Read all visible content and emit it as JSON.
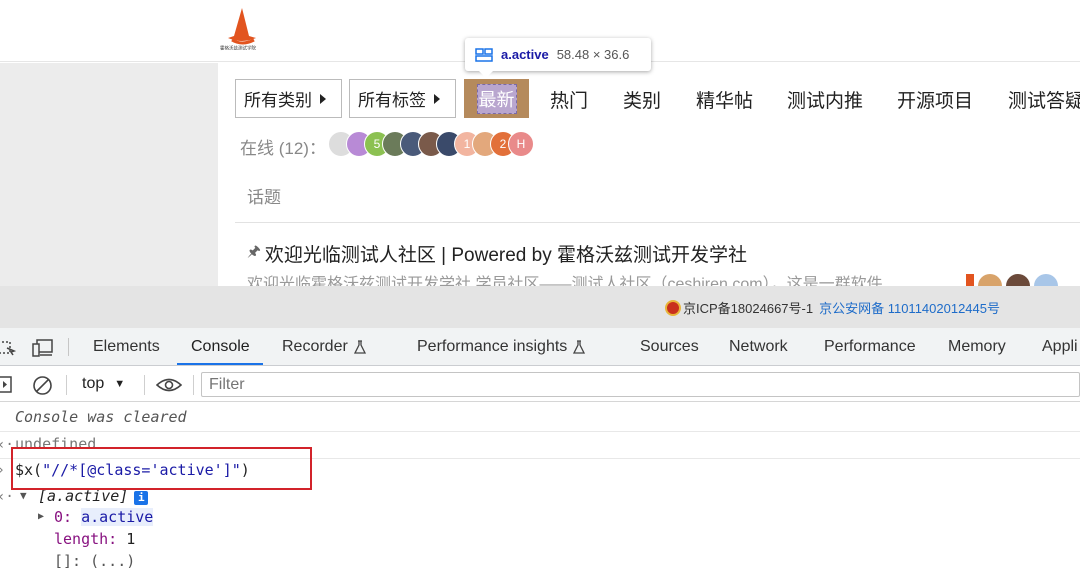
{
  "site": {
    "logo_text": "霍格沃兹测试学院",
    "filters": [
      {
        "label": "所有类别"
      },
      {
        "label": "所有标签"
      }
    ],
    "nav": [
      {
        "label": "最新"
      },
      {
        "label": "热门"
      },
      {
        "label": "类别"
      },
      {
        "label": "精华帖"
      },
      {
        "label": "测试内推"
      },
      {
        "label": "开源项目"
      },
      {
        "label": "测试答疑"
      }
    ],
    "online_label": "在线 (12)：",
    "online_badges": [
      "5",
      "1",
      "2",
      "H"
    ],
    "topics_header": "话题",
    "pinned_topic": {
      "pin_icon": "pin-icon",
      "title": "欢迎光临测试人社区 | Powered by 霍格沃兹测试开发学社",
      "excerpt": "欢迎光临霍格沃兹测试开发学社 学员社区——测试人社区（ceshiren.com），这是一群软件"
    },
    "footer": {
      "icp": "京ICP备18024667号-1",
      "police": "京公安网备 11011402012445号"
    }
  },
  "inspector_tooltip": {
    "selector": "a.active",
    "size": "58.48 × 36.6"
  },
  "devtools": {
    "tabs": [
      {
        "label": "Elements"
      },
      {
        "label": "Console"
      },
      {
        "label": "Recorder"
      },
      {
        "label": "Performance insights"
      },
      {
        "label": "Sources"
      },
      {
        "label": "Network"
      },
      {
        "label": "Performance"
      },
      {
        "label": "Memory"
      },
      {
        "label": "Appli"
      }
    ],
    "active_tab": "Console",
    "context": "top",
    "filter_placeholder": "Filter",
    "console": {
      "cleared": "Console was cleared",
      "undefined": "undefined",
      "command_prefix": "$x(",
      "command_string": "\"//*[@class='active']\"",
      "command_suffix": ")",
      "result": "[a.active]",
      "info_badge": "i",
      "item0_key": "0:",
      "item0_value": "a.active",
      "length_key": "length:",
      "length_value": "1",
      "proto": "[]: (...)"
    }
  },
  "colors": {
    "active_nav_bg": "#b58a5c",
    "devtools_accent": "#1a73e8",
    "highlight_box": "#d2232a"
  }
}
